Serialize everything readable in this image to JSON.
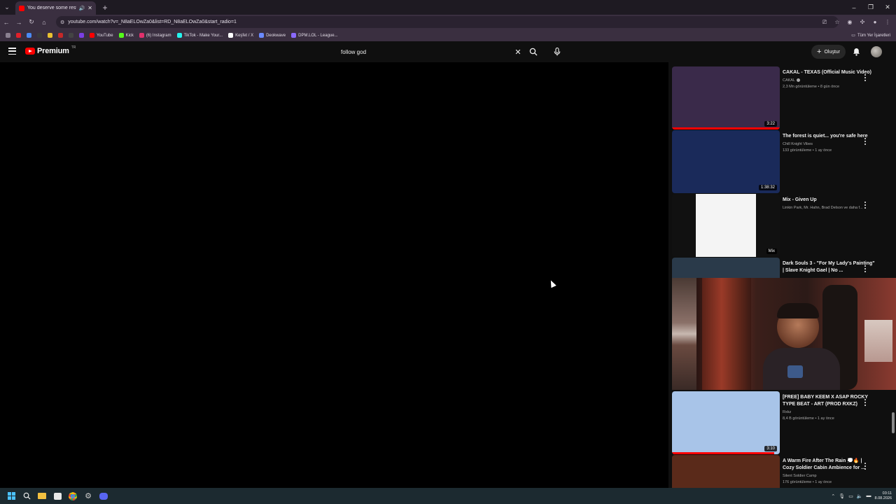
{
  "browser": {
    "tab_title": "You deserve some rest...",
    "url": "youtube.com/watch?v=_N8aELOwZa0&list=RD_N8aELOwZa0&start_radio=1",
    "bookmarks": [
      {
        "label": "",
        "color": "#e0202a"
      },
      {
        "label": "",
        "color": "#4a8af4"
      },
      {
        "label": "",
        "color": "#3a3a3a"
      },
      {
        "label": "",
        "color": "#e8c030"
      },
      {
        "label": "",
        "color": "#c62828"
      },
      {
        "label": "",
        "color": "#444444"
      },
      {
        "label": "",
        "color": "#7b3fe4"
      },
      {
        "label": "YouTube",
        "color": "#ff0000"
      },
      {
        "label": "Kick",
        "color": "#53fc18"
      },
      {
        "label": "(6) Instagram",
        "color": "#e1306c"
      },
      {
        "label": "TikTok - Make Your...",
        "color": "#25f4ee"
      },
      {
        "label": "Keşfet / X",
        "color": "#ffffff"
      },
      {
        "label": "Deokwave",
        "color": "#6a8aff"
      },
      {
        "label": "DPM.LOL - League...",
        "color": "#8a6aff"
      }
    ],
    "bookmarks_all": "Tüm Yer İşaretleri"
  },
  "youtube": {
    "logo_text": "Premium",
    "country_code": "TR",
    "search_value": "follow god",
    "create_label": "Oluştur"
  },
  "sidebar": {
    "videos": [
      {
        "title": "CAKAL - TEXAS (Official Music Video)",
        "channel": "CAKAL",
        "verified": true,
        "stats": "2,3 Mn görüntüleme • 8 gün önce",
        "duration": "3:22",
        "progress": 1.0,
        "thumb": "#3a2a4a"
      },
      {
        "title": "The forest is quiet... you're safe here",
        "channel": "Chill Knight Vibes",
        "verified": false,
        "stats": "133 görüntüleme • 1 ay önce",
        "duration": "1:38:32",
        "progress": 0,
        "thumb": "#1a2a5a"
      },
      {
        "title": "Mix - Given Up",
        "channel": "Linkin Park, Mr. Hahn, Brad Delson ve daha f...",
        "verified": false,
        "stats": "",
        "duration": "Mix",
        "progress": 0,
        "thumb": "#ffffff"
      },
      {
        "title": "Dark Souls 3 - \"For My Lady's Painting\" | Slave Knight Gael | No ...",
        "channel": "",
        "verified": false,
        "stats": "",
        "duration": "",
        "progress": 0,
        "thumb": "#2a3a4a"
      },
      {
        "title": "[FREE] BABY KEEM X ASAP ROCKY TYPE BEAT - ART (PROD RXKZ)",
        "channel": "Rxkz",
        "verified": false,
        "stats": "8,4 B görüntüleme • 1 ay önce",
        "duration": "3:10",
        "progress": 0.95,
        "thumb": "#a8c4e8"
      },
      {
        "title": "A Warm Fire After The Rain 💭🔥 | Cozy Soldier Cabin Ambience for ...",
        "channel": "Silent Soldier Camp",
        "verified": false,
        "stats": "176 görüntüleme • 1 ay önce",
        "duration": "",
        "progress": 0,
        "thumb": "#5a2a1a"
      }
    ]
  },
  "taskbar": {
    "time": "03:11",
    "date": "8.08.2026"
  }
}
